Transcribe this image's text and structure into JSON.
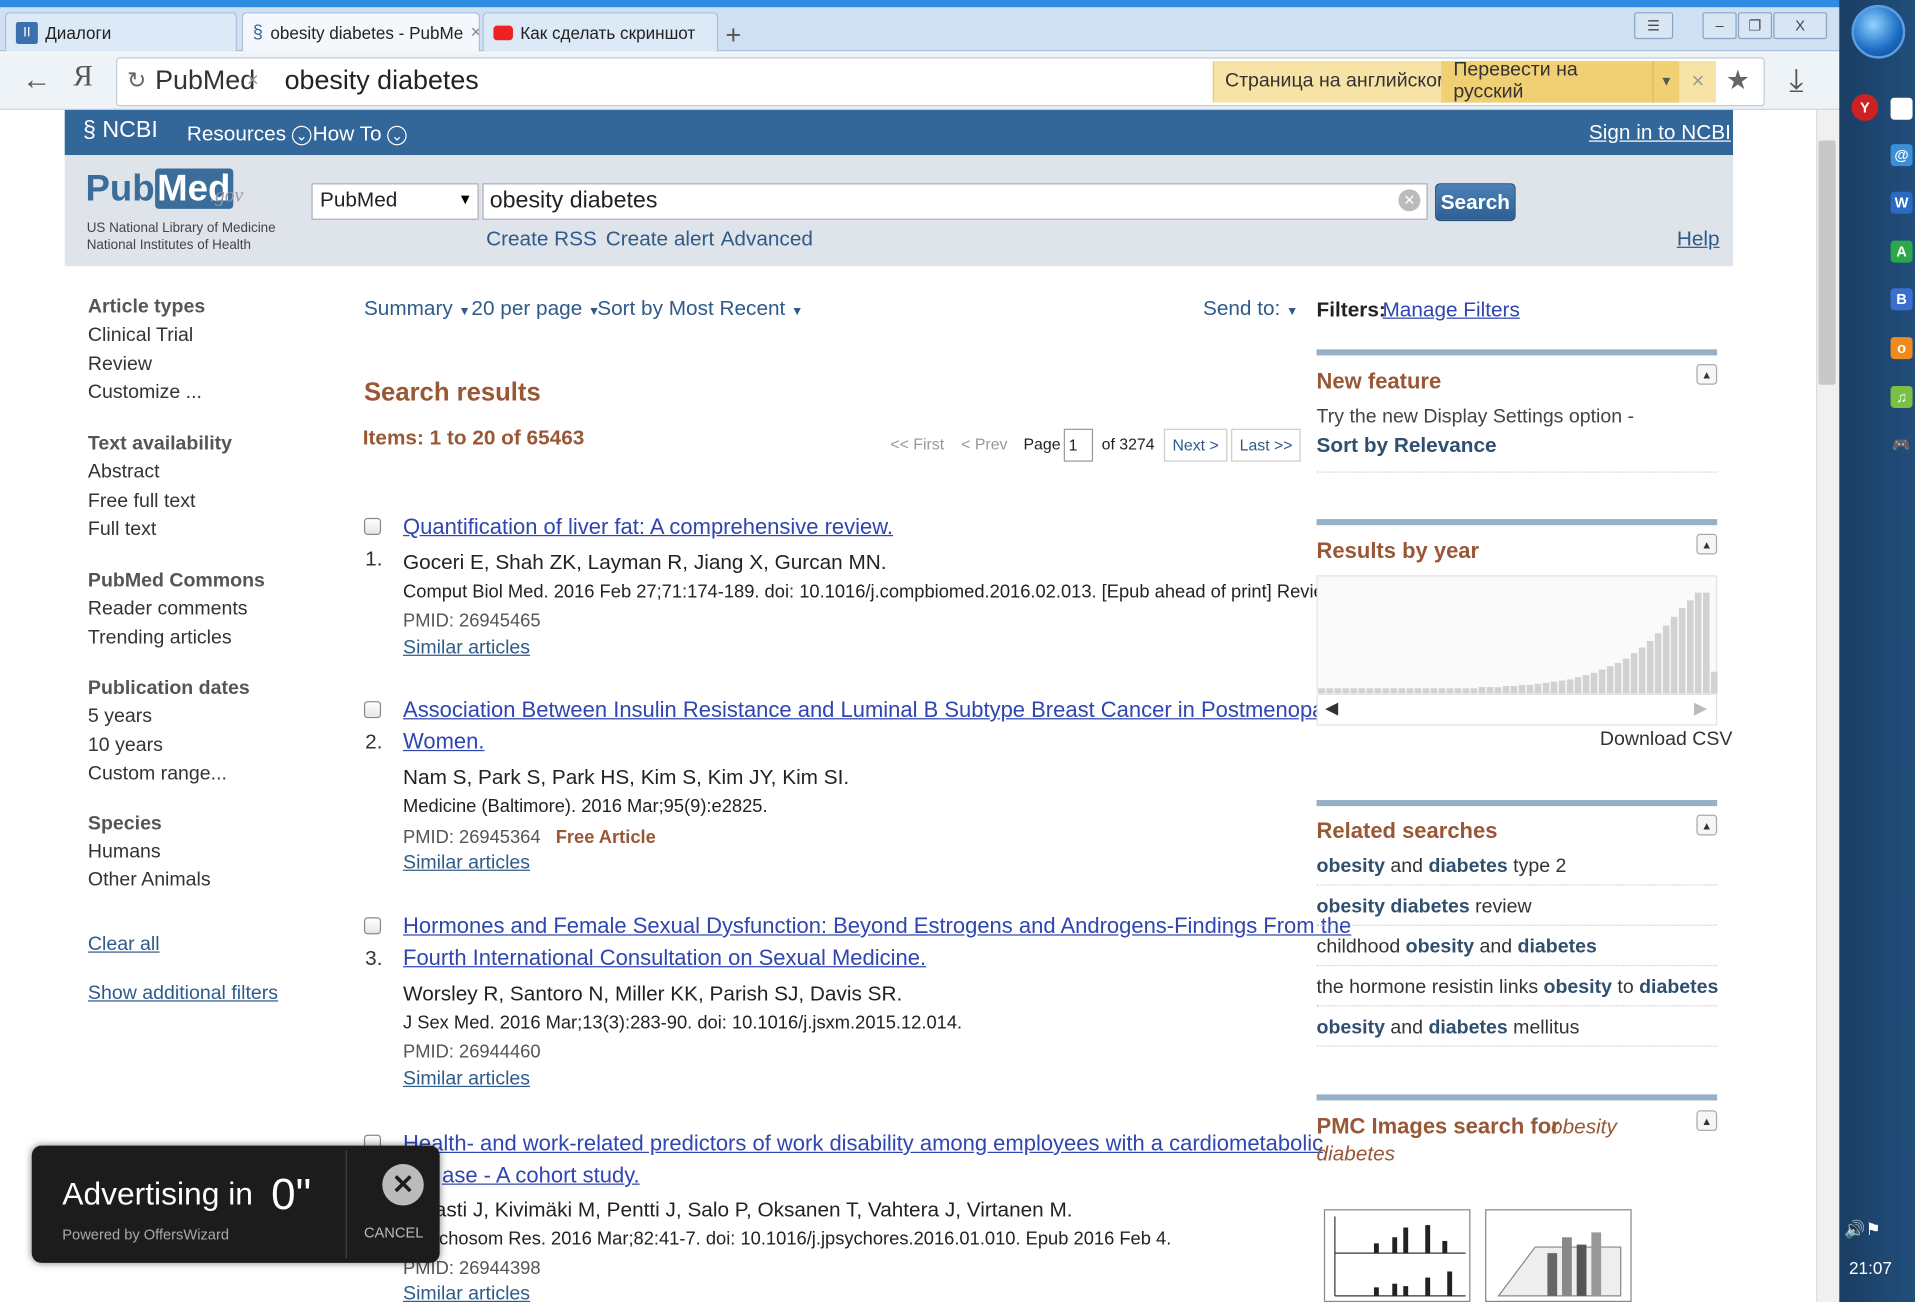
{
  "browser": {
    "tabs": [
      {
        "label": "Диалоги"
      },
      {
        "label": "obesity diabetes - PubMe"
      },
      {
        "label": "Как сделать скриншот"
      }
    ],
    "site_name": "PubMed",
    "url_text": "obesity diabetes",
    "translate_notice": "Страница на английском",
    "translate_button": "Перевести на русский",
    "clock": "21:07"
  },
  "ncbi": {
    "logo": "NCBI",
    "resources": "Resources",
    "howto": "How To",
    "signin": "Sign in to NCBI"
  },
  "search": {
    "logo_pub": "Pub",
    "logo_med": "Med",
    "logo_gov": ".gov",
    "nlm_line1": "US National Library of Medicine",
    "nlm_line2": "National Institutes of Health",
    "database": "PubMed",
    "query": "obesity diabetes",
    "button": "Search",
    "create_rss": "Create RSS",
    "create_alert": "Create alert",
    "advanced": "Advanced",
    "help": "Help"
  },
  "filters": {
    "article_types": {
      "header": "Article types",
      "items": [
        "Clinical Trial",
        "Review",
        "Customize ..."
      ]
    },
    "text_availability": {
      "header": "Text availability",
      "items": [
        "Abstract",
        "Free full text",
        "Full text"
      ]
    },
    "pubmed_commons": {
      "header": "PubMed Commons",
      "items": [
        "Reader comments",
        "Trending articles"
      ]
    },
    "publication_dates": {
      "header": "Publication dates",
      "items": [
        "5 years",
        "10 years",
        "Custom range..."
      ]
    },
    "species": {
      "header": "Species",
      "items": [
        "Humans",
        "Other Animals"
      ]
    },
    "clear_all": "Clear all",
    "show_additional": "Show additional filters"
  },
  "controls": {
    "summary": "Summary",
    "per_page": "20 per page",
    "sort": "Sort by Most Recent",
    "send_to": "Send to:"
  },
  "results": {
    "title": "Search results",
    "items": "Items: 1 to 20 of 65463",
    "pager": {
      "first": "<< First",
      "prev": "< Prev",
      "page_label": "Page",
      "page": "1",
      "of": "of 3274",
      "next": "Next >",
      "last": "Last >>"
    },
    "list": [
      {
        "num": "1.",
        "title": "Quantification of liver fat: A comprehensive review.",
        "authors": "Goceri E, Shah ZK, Layman R, Jiang X, Gurcan MN.",
        "citation": "Comput Biol Med. 2016 Feb 27;71:174-189. doi: 10.1016/j.compbiomed.2016.02.013. [Epub ahead of print] Review.",
        "pmid": "PMID: 26945465",
        "similar": "Similar articles"
      },
      {
        "num": "2.",
        "title_line1": "Association Between Insulin Resistance and Luminal B Subtype Breast Cancer in Postmenopausal",
        "title_line2": "Women.",
        "authors": "Nam S, Park S, Park HS, Kim S, Kim JY, Kim SI.",
        "citation": "Medicine (Baltimore). 2016 Mar;95(9):e2825.",
        "pmid": "PMID: 26945364",
        "free": "Free Article",
        "similar": "Similar articles"
      },
      {
        "num": "3.",
        "title_line1": "Hormones and Female Sexual Dysfunction: Beyond Estrogens and Androgens-Findings From the",
        "title_line2": "Fourth International Consultation on Sexual Medicine.",
        "authors": "Worsley R, Santoro N, Miller KK, Parish SJ, Davis SR.",
        "citation": "J Sex Med. 2016 Mar;13(3):283-90. doi: 10.1016/j.jsxm.2015.12.014.",
        "pmid": "PMID: 26944460",
        "similar": "Similar articles"
      },
      {
        "num": "4.",
        "title_line1": "Health- and work-related predictors of work disability among employees with a cardiometabolic",
        "title_line2": "ase - A cohort study.",
        "authors": "asti J, Kivimäki M, Pentti J, Salo P, Oksanen T, Vahtera J, Virtanen M.",
        "citation": "ychosom Res. 2016 Mar;82:41-7. doi: 10.1016/j.jpsychores.2016.01.010. Epub 2016 Feb 4.",
        "pmid": "PMID: 26944398",
        "similar": "Similar articles"
      }
    ]
  },
  "sidebar": {
    "filters_label": "Filters:",
    "manage_filters": "Manage Filters",
    "new_feature": {
      "header": "New feature",
      "text": "Try the new Display Settings option -",
      "link": "Sort by Relevance"
    },
    "results_by_year": {
      "header": "Results by year",
      "download": "Download CSV",
      "bar_levels": [
        0.05,
        0.05,
        0.05,
        0.05,
        0.05,
        0.05,
        0.05,
        0.05,
        0.05,
        0.05,
        0.05,
        0.05,
        0.05,
        0.05,
        0.05,
        0.05,
        0.05,
        0.05,
        0.05,
        0.05,
        0.06,
        0.06,
        0.06,
        0.07,
        0.07,
        0.08,
        0.08,
        0.09,
        0.1,
        0.11,
        0.12,
        0.13,
        0.15,
        0.17,
        0.19,
        0.22,
        0.25,
        0.28,
        0.32,
        0.37,
        0.42,
        0.48,
        0.55,
        0.62,
        0.7,
        0.78,
        0.85,
        0.92,
        0.92,
        0.2
      ]
    },
    "related": {
      "header": "Related searches",
      "items": [
        [
          {
            "b": "obesity"
          },
          {
            "t": " and "
          },
          {
            "b": "diabetes"
          },
          {
            "t": " type 2"
          }
        ],
        [
          {
            "b": "obesity diabetes"
          },
          {
            "t": " review"
          }
        ],
        [
          {
            "t": "childhood "
          },
          {
            "b": "obesity"
          },
          {
            "t": " and "
          },
          {
            "b": "diabetes"
          }
        ],
        [
          {
            "t": "the hormone resistin links "
          },
          {
            "b": "obesity"
          },
          {
            "t": " to "
          },
          {
            "b": "diabetes"
          }
        ],
        [
          {
            "b": "obesity"
          },
          {
            "t": " and "
          },
          {
            "b": "diabetes"
          },
          {
            "t": " mellitus"
          }
        ]
      ]
    },
    "pmc": {
      "header": "PMC Images search for",
      "query1": "obesity",
      "query2": "diabetes"
    }
  },
  "ad": {
    "text": "Advertising in",
    "countdown": "0\"",
    "powered": "Powered by OffersWizard",
    "cancel": "CANCEL"
  }
}
